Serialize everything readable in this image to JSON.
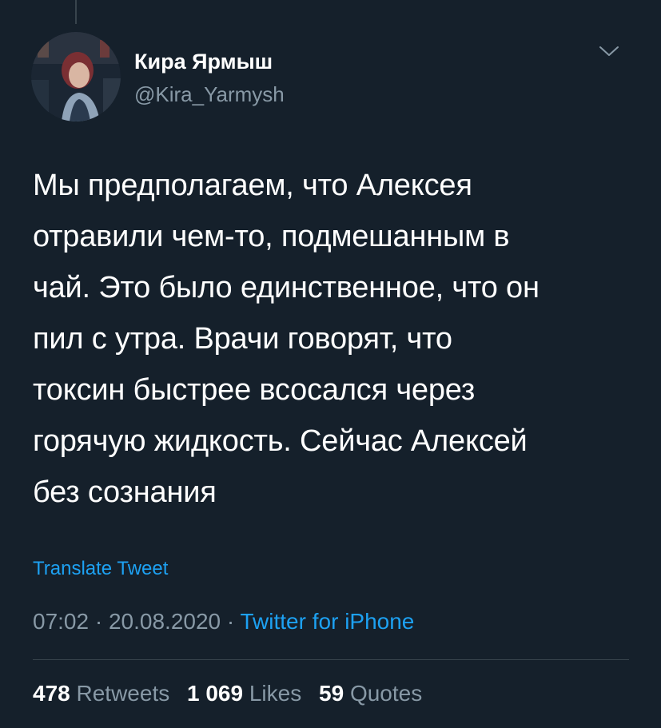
{
  "tweet": {
    "author_name": "Кира Ярмыш",
    "author_handle": "@Kira_Yarmysh",
    "text": "Мы предполагаем, что Алексея\nотравили чем-то, подмешанным в\nчай. Это было единственное, что он\nпил с утра. Врачи говорят, что\nтоксин быстрее всосался через\nгорячую жидкость. Сейчас Алексей\nбез сознания",
    "translate_label": "Translate Tweet",
    "time": "07:02",
    "date": "20.08.2020",
    "separator": "·",
    "source": "Twitter for iPhone"
  },
  "stats": {
    "retweets_count": "478",
    "retweets_label": "Retweets",
    "likes_count": "1 069",
    "likes_label": "Likes",
    "quotes_count": "59",
    "quotes_label": "Quotes"
  },
  "icons": {
    "more_menu": "chevron-down-icon"
  },
  "colors": {
    "background": "#15202b",
    "text_primary": "#ffffff",
    "text_secondary": "#8899a6",
    "accent": "#1da1f2",
    "divider": "#38444d"
  }
}
